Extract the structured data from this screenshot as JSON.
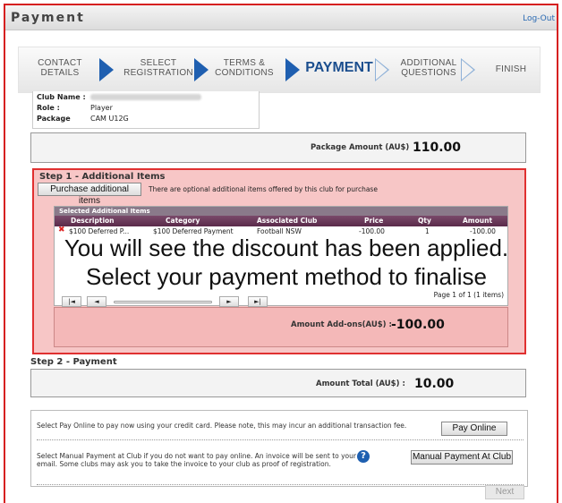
{
  "window": {
    "title": "Payment",
    "logout": "Log-Out"
  },
  "wizard": {
    "steps": [
      {
        "line1": "CONTACT",
        "line2": "DETAILS"
      },
      {
        "line1": "SELECT",
        "line2": "REGISTRATION"
      },
      {
        "line1": "TERMS &",
        "line2": "CONDITIONS"
      },
      {
        "line1": "PAYMENT",
        "line2": ""
      },
      {
        "line1": "ADDITIONAL",
        "line2": "QUESTIONS"
      },
      {
        "line1": "FINISH",
        "line2": ""
      }
    ],
    "active": "PAYMENT"
  },
  "info": {
    "club_label": "Club Name :",
    "role_label": "Role :",
    "role_value": "Player",
    "package_label": "Package",
    "package_value": "CAM U12G"
  },
  "package_amount": {
    "label": "Package Amount (AU$)",
    "value": "110.00"
  },
  "step1": {
    "title": "Step 1 - Additional Items",
    "button": "Purchase additional items",
    "note": "There are optional additional items offered by this club for purchase",
    "grid": {
      "caption": "Selected Additional Items",
      "columns": [
        "Description",
        "Category",
        "Associated Club",
        "Price",
        "Qty",
        "Amount"
      ],
      "rows": [
        {
          "description": "$100 Deferred P...",
          "category": "$100 Deferred Payment",
          "club": "Football NSW",
          "price": "-100.00",
          "qty": "1",
          "amount": "-100.00"
        }
      ],
      "pager": {
        "first": "|◄",
        "prev": "◄",
        "next": "►",
        "last": "►|",
        "info": "Page 1 of 1 (1 items)"
      }
    },
    "addon_label": "Amount Add-ons(AU$) :",
    "addon_value": "-100.00"
  },
  "overlay": {
    "line1": "You will see the discount has been applied.",
    "line2": "Select your payment method to finalise"
  },
  "step2": {
    "title": "Step 2 - Payment",
    "total_label": "Amount Total (AU$) :",
    "total_value": "10.00"
  },
  "payment": {
    "online_text": "Select Pay Online to pay now using your credit card. Please note, this may incur an additional transaction fee.",
    "online_button": "Pay Online",
    "manual_text": "Select Manual Payment at Club if you do not want to pay online. An invoice will be sent to your email. Some clubs may ask you to take the invoice to your club as proof of registration.",
    "manual_button": "Manual Payment At Club",
    "help_icon": "?"
  },
  "next_button": "Next",
  "colors": {
    "highlight_border": "#e03030",
    "highlight_bg": "#f7c6c6",
    "active_step": "#1b4e8e",
    "grid_header": "#6a3a5a"
  }
}
